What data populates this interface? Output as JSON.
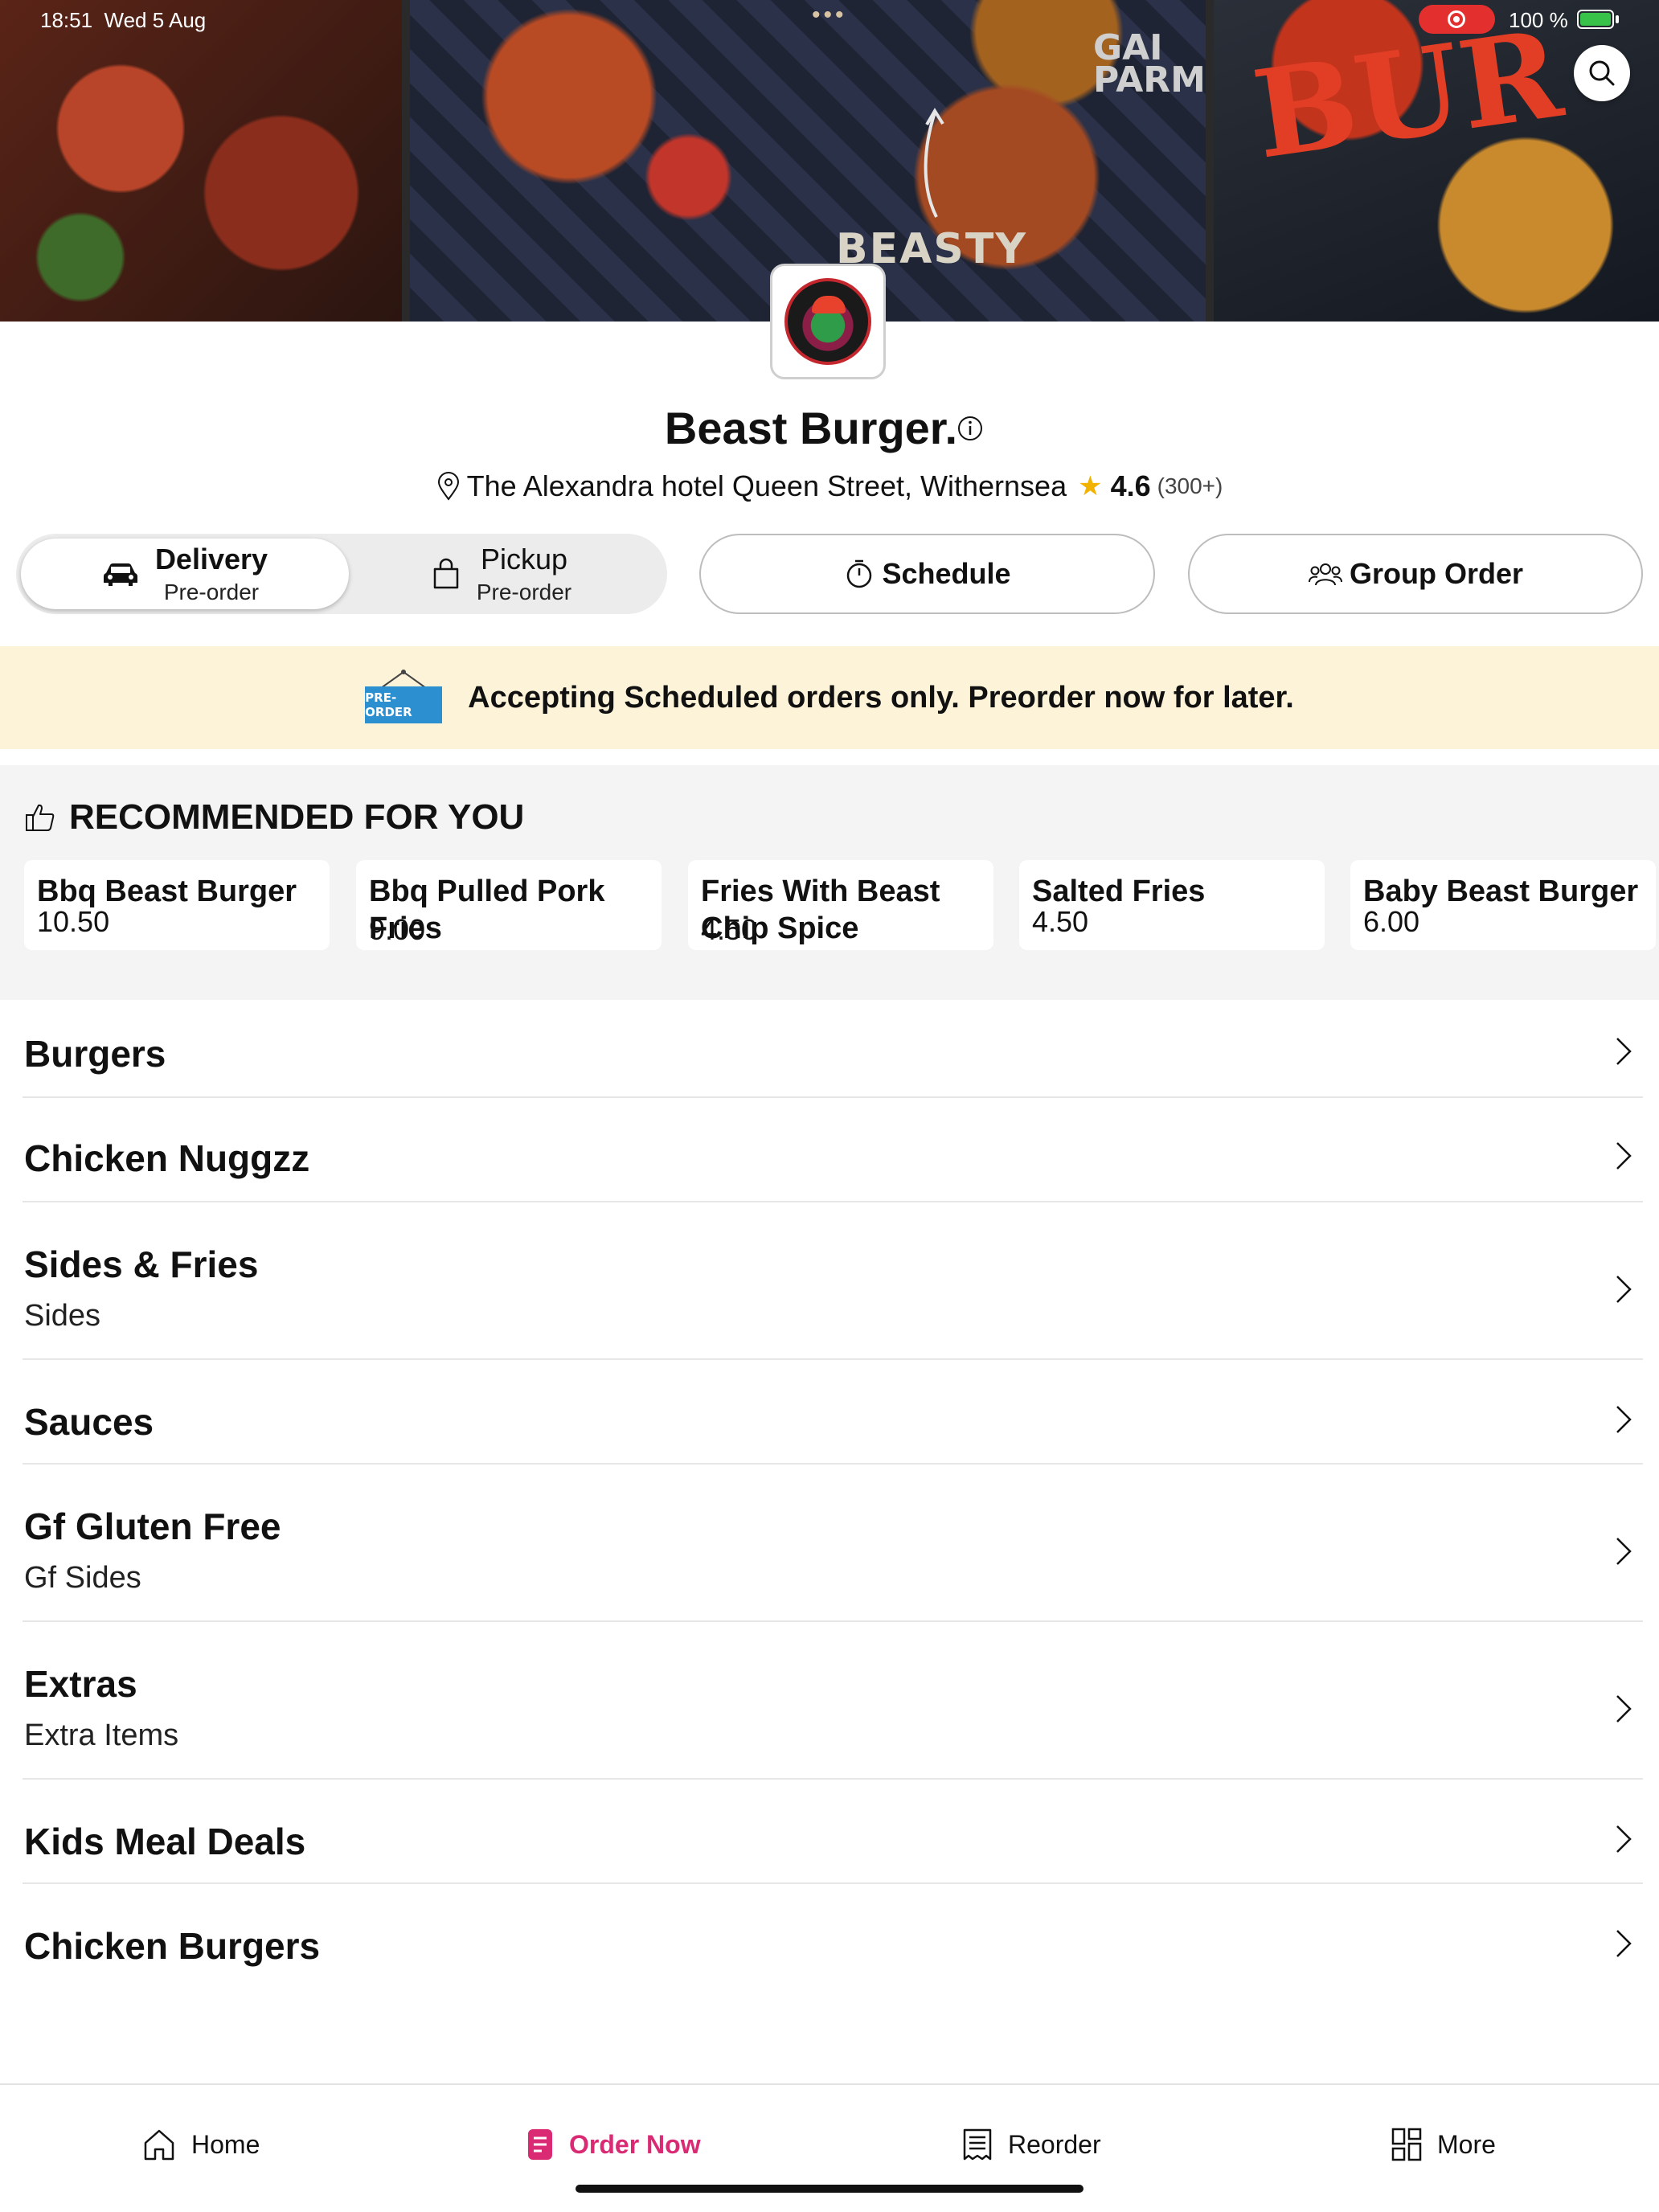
{
  "status_bar": {
    "time": "18:51",
    "date": "Wed 5 Aug",
    "battery": "100 %"
  },
  "hero": {
    "text_beasty": "BEASTY",
    "text_gai": "GAI\nPARM",
    "text_burg": "BUR"
  },
  "restaurant": {
    "name": "Beast Burger.",
    "address": "The Alexandra hotel Queen Street, Withernsea",
    "rating": "4.6",
    "rating_count": "(300+)"
  },
  "modes": {
    "delivery": {
      "label": "Delivery",
      "sub": "Pre-order"
    },
    "pickup": {
      "label": "Pickup",
      "sub": "Pre-order"
    },
    "schedule": "Schedule",
    "group_order": "Group Order"
  },
  "banner": {
    "badge": "PRE-ORDER",
    "message": "Accepting Scheduled orders only. Preorder now for later."
  },
  "recommended": {
    "title": "RECOMMENDED FOR YOU",
    "items": [
      {
        "name": "Bbq Beast Burger",
        "price": "10.50"
      },
      {
        "name": "Bbq Pulled Pork Fries",
        "price": "9.00"
      },
      {
        "name": "Fries With Beast Chip Spice",
        "price": "4.50"
      },
      {
        "name": "Salted Fries",
        "price": "4.50"
      },
      {
        "name": "Baby Beast Burger",
        "price": "6.00"
      }
    ]
  },
  "categories": [
    {
      "title": "Burgers",
      "subtitle": ""
    },
    {
      "title": "Chicken Nuggzz",
      "subtitle": ""
    },
    {
      "title": "Sides & Fries",
      "subtitle": "Sides"
    },
    {
      "title": "Sauces",
      "subtitle": ""
    },
    {
      "title": "Gf Gluten Free",
      "subtitle": "Gf Sides"
    },
    {
      "title": "Extras",
      "subtitle": "Extra Items"
    },
    {
      "title": "Kids Meal Deals",
      "subtitle": ""
    },
    {
      "title": "Chicken Burgers",
      "subtitle": ""
    }
  ],
  "tabs": {
    "home": "Home",
    "order_now": "Order Now",
    "reorder": "Reorder",
    "more": "More"
  },
  "colors": {
    "accent": "#d92a73",
    "banner_bg": "#fdf3d8",
    "star": "#f2b200",
    "badge_blue": "#2c8fd0"
  }
}
